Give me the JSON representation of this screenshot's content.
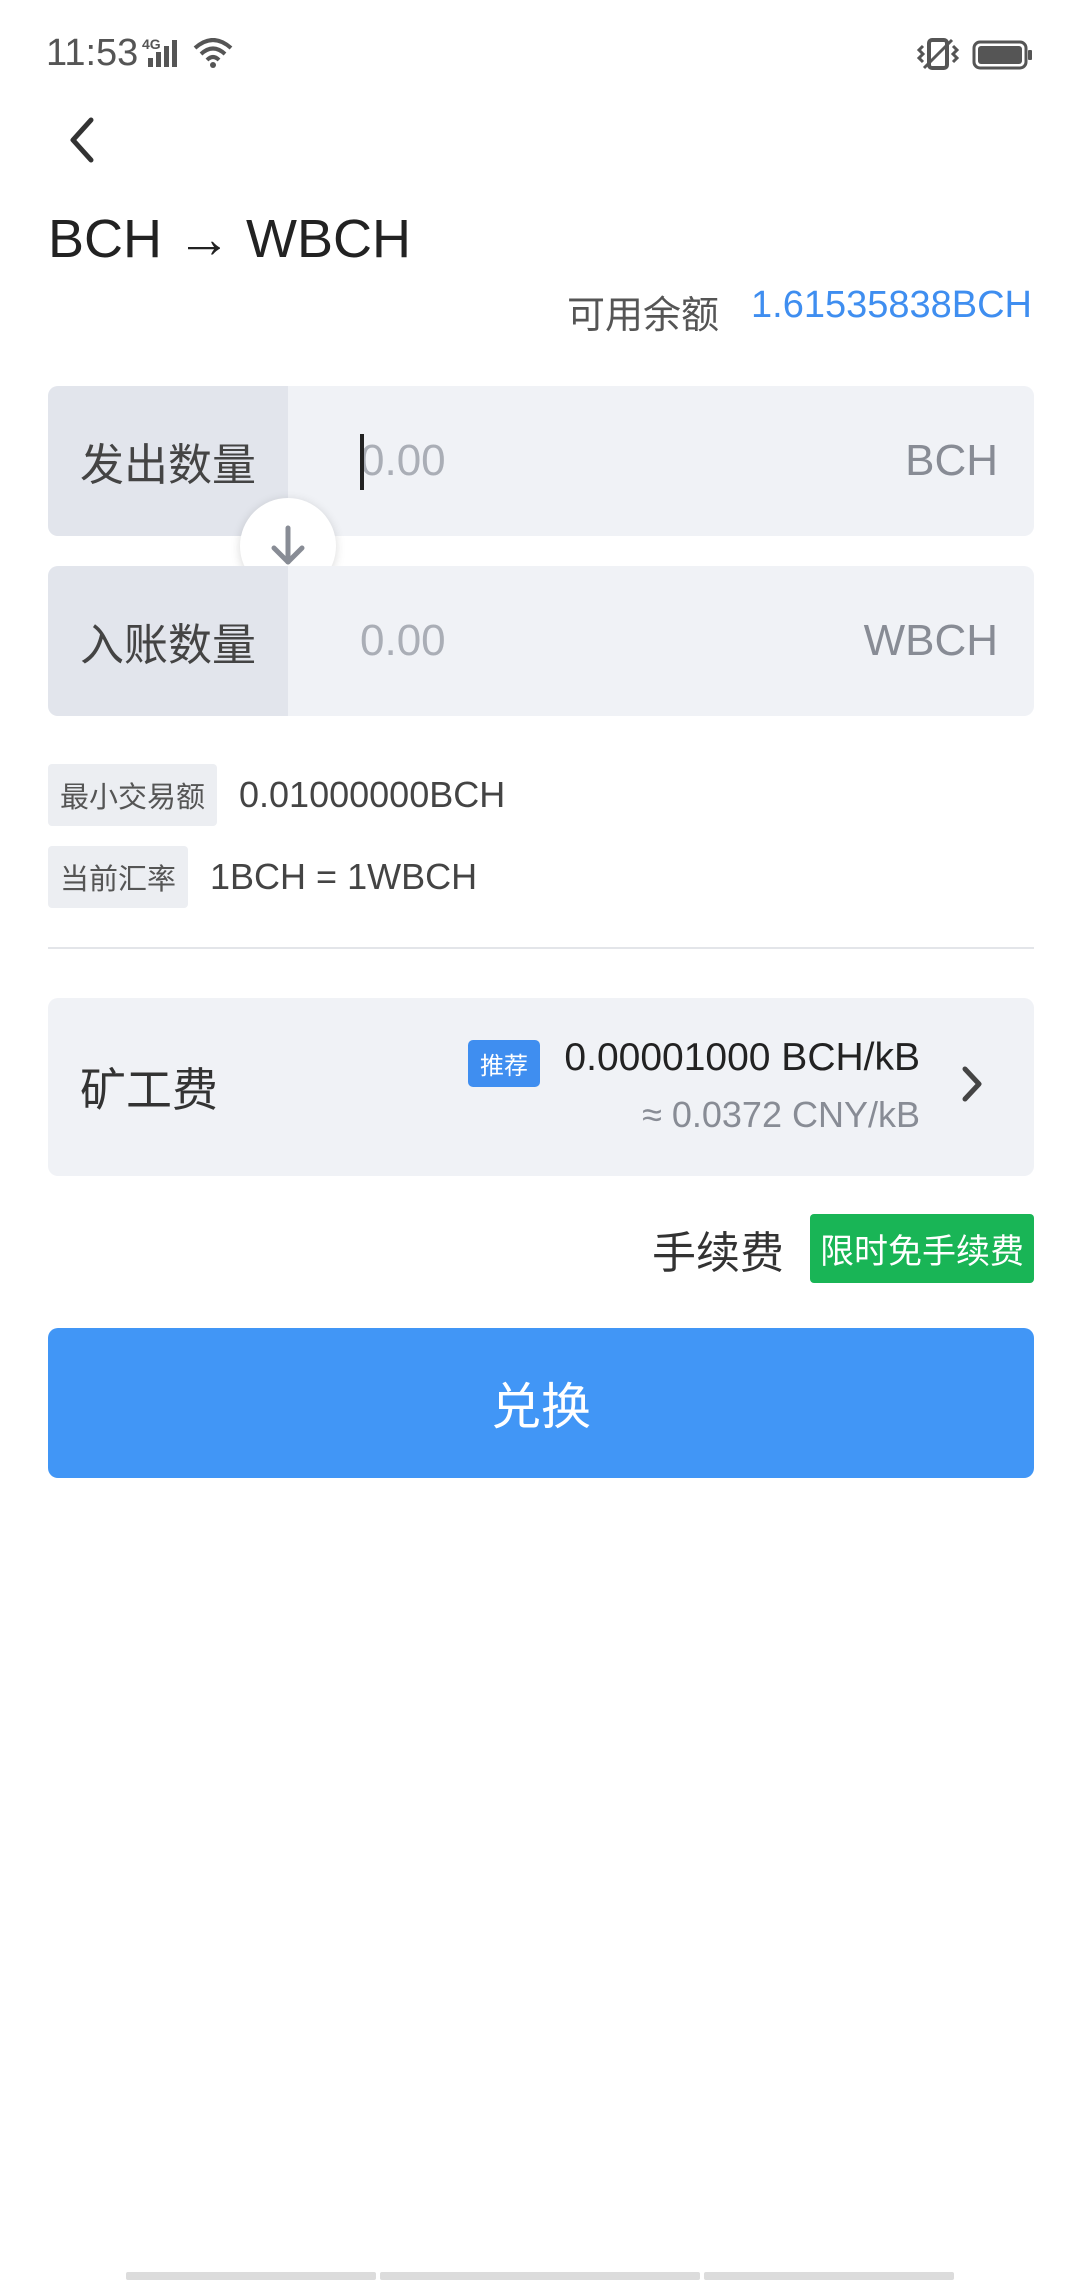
{
  "status": {
    "time": "11:53",
    "network": "4G"
  },
  "header": {
    "title": "BCH → WBCH"
  },
  "balance": {
    "label": "可用余额",
    "value": "1.61535838BCH"
  },
  "send": {
    "label": "发出数量",
    "placeholder": "0.00",
    "unit": "BCH"
  },
  "receive": {
    "label": "入账数量",
    "value": "0.00",
    "unit": "WBCH"
  },
  "info": {
    "min_label": "最小交易额",
    "min_value": "0.01000000BCH",
    "rate_label": "当前汇率",
    "rate_value": "1BCH = 1WBCH"
  },
  "miner_fee": {
    "label": "矿工费",
    "recommend": "推荐",
    "value": "0.00001000 BCH/kB",
    "approx": "≈ 0.0372 CNY/kB"
  },
  "service_fee": {
    "label": "手续费",
    "badge": "限时免手续费"
  },
  "exchange_button": "兑换",
  "colors": {
    "accent": "#4196f6",
    "free_badge": "#19b556"
  }
}
